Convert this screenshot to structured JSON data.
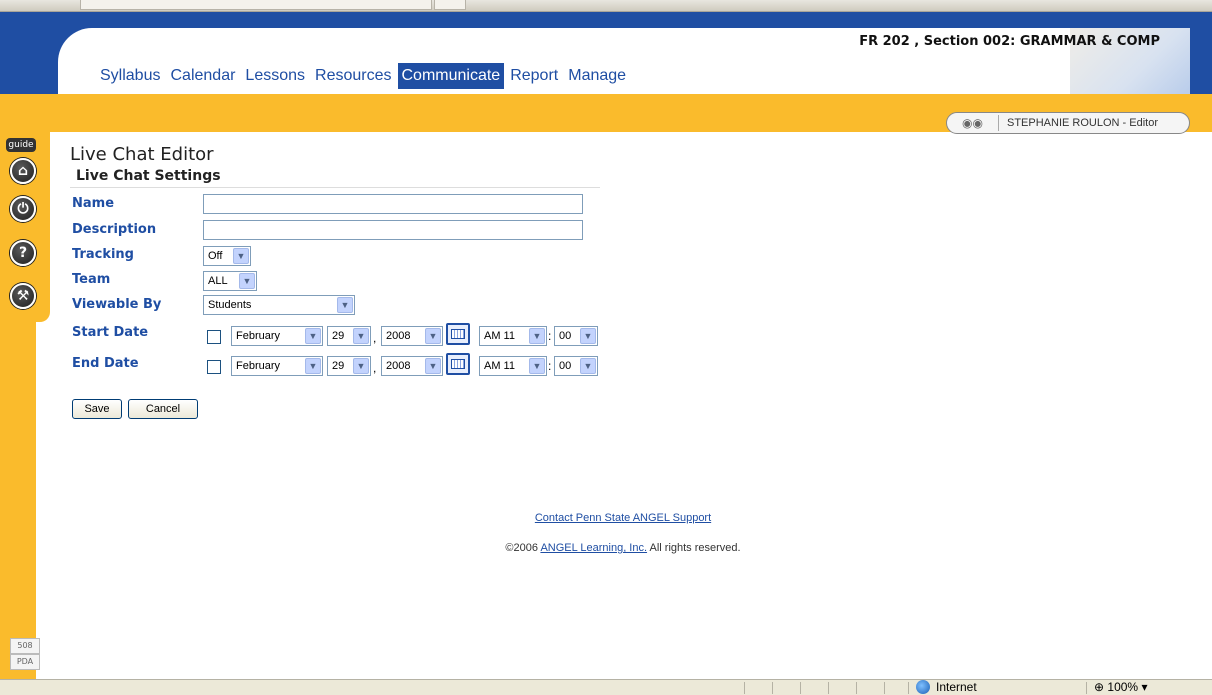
{
  "course": {
    "title": "FR 202 , Section 002: GRAMMAR & COMP"
  },
  "nav": {
    "items": [
      {
        "label": "Syllabus"
      },
      {
        "label": "Calendar"
      },
      {
        "label": "Lessons"
      },
      {
        "label": "Resources"
      },
      {
        "label": "Communicate",
        "active": true
      },
      {
        "label": "Report"
      },
      {
        "label": "Manage"
      }
    ]
  },
  "sidebar": {
    "guide_label": "guide",
    "badge_508": "508",
    "badge_pda": "PDA",
    "buttons": [
      {
        "icon": "home-icon"
      },
      {
        "icon": "power-icon"
      },
      {
        "icon": "help-icon"
      },
      {
        "icon": "tools-icon"
      }
    ]
  },
  "user": {
    "name": "STEPHANIE ROULON - Editor"
  },
  "page": {
    "title": "Live Chat Editor",
    "section": "Live Chat Settings"
  },
  "form": {
    "name_label": "Name",
    "name_value": "",
    "description_label": "Description",
    "description_value": "",
    "tracking_label": "Tracking",
    "tracking_value": "Off",
    "team_label": "Team",
    "team_value": "ALL",
    "viewable_label": "Viewable By",
    "viewable_value": "Students",
    "start": {
      "label": "Start Date",
      "month": "February",
      "day": "29",
      "year": "2008",
      "ampm_hour": "AM 11",
      "minute": "00"
    },
    "end": {
      "label": "End Date",
      "month": "February",
      "day": "29",
      "year": "2008",
      "ampm_hour": "AM 11",
      "minute": "00"
    },
    "save_label": "Save",
    "cancel_label": "Cancel"
  },
  "footer": {
    "support_link": "Contact Penn State ANGEL Support",
    "copy_prefix": "©2006 ",
    "copy_link": "ANGEL Learning, Inc.",
    "copy_suffix": " All rights reserved."
  },
  "status": {
    "zone": "Internet",
    "zoom": "100%"
  },
  "colors": {
    "brand_blue": "#1f4ea3",
    "frame_orange": "#fabb2c"
  }
}
